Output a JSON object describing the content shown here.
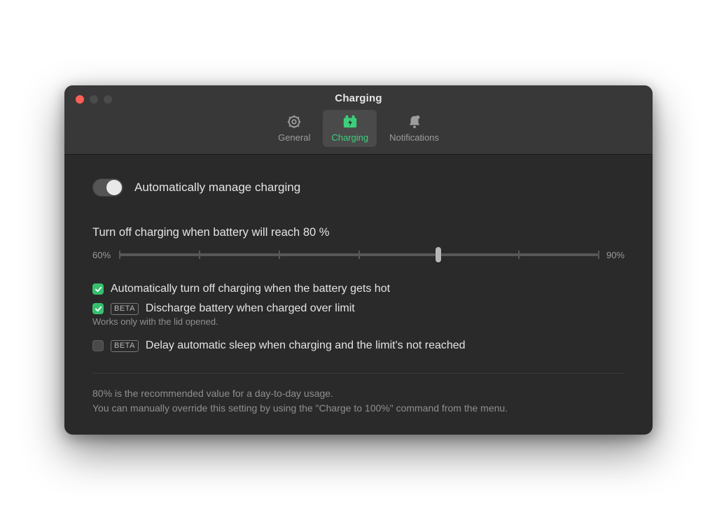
{
  "window": {
    "title": "Charging"
  },
  "tabs": {
    "general": {
      "label": "General"
    },
    "charging": {
      "label": "Charging",
      "active": true
    },
    "notifications": {
      "label": "Notifications"
    }
  },
  "accent": "#35c06e",
  "auto_manage": {
    "label": "Automatically manage charging",
    "enabled": false
  },
  "slider": {
    "label": "Turn off charging when battery will reach 80 %",
    "min_label": "60%",
    "max_label": "90%",
    "min": 60,
    "max": 90,
    "value": 80,
    "percent_position": 66.67
  },
  "checks": {
    "hot": {
      "checked": true,
      "label": "Automatically turn off charging when the battery gets hot"
    },
    "discharge": {
      "checked": true,
      "beta": "BETA",
      "label": "Discharge battery when charged over limit",
      "hint": "Works only with the lid opened."
    },
    "delay_sleep": {
      "checked": false,
      "beta": "BETA",
      "label": "Delay automatic sleep when charging and the limit's not reached"
    }
  },
  "footer": {
    "line1": "80% is the recommended value for a day-to-day usage.",
    "line2": "You can manually override this setting by using the \"Charge to 100%\" command from the menu."
  }
}
